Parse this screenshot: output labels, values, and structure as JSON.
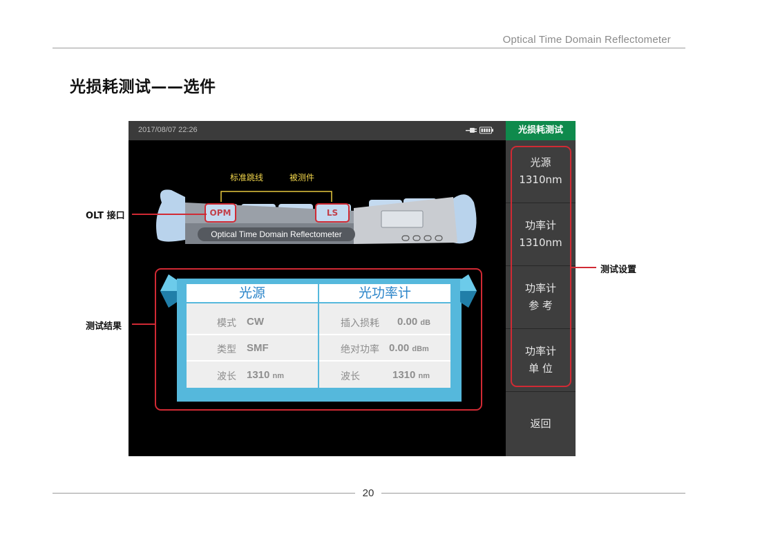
{
  "header": {
    "text": "Optical Time Domain Reflectometer"
  },
  "page_title": "光损耗测试——选件",
  "screen": {
    "datetime": "2017/08/07  22:26",
    "icons": [
      "plug-icon",
      "battery-icon"
    ],
    "side_header": "光损耗测试",
    "side_buttons": [
      {
        "line1": "光源",
        "line2": "1310nm"
      },
      {
        "line1": "功率计",
        "line2": "1310nm"
      },
      {
        "line1": "功率计",
        "line2": "参 考"
      },
      {
        "line1": "功率计",
        "line2": "单 位"
      },
      {
        "line1": "返回",
        "line2": ""
      }
    ],
    "illustration": {
      "label_jumper": "标准跳线",
      "label_dut": "被测件",
      "port_opm": "OPM",
      "port_ls": "LS",
      "device_name": "Optical Time Domain Reflectometer"
    },
    "results": {
      "left_title": "光源",
      "right_title": "光功率计",
      "left_rows": [
        {
          "label": "模式",
          "value": "CW"
        },
        {
          "label": "类型",
          "value": "SMF"
        },
        {
          "label": "波长",
          "value": "1310",
          "unit": "nm"
        }
      ],
      "right_rows": [
        {
          "label": "插入损耗",
          "value": "0.00",
          "unit": "dB"
        },
        {
          "label": "绝对功率",
          "value": "0.00",
          "unit": "dBm"
        },
        {
          "label": "波长",
          "value": "1310",
          "unit": "nm"
        }
      ]
    }
  },
  "annotations": {
    "olt": "OLT 接口",
    "results": "测试结果",
    "settings": "测试设置"
  },
  "footer": {
    "page": "20"
  },
  "colors": {
    "accent_green": "#0f8a4c",
    "highlight_red": "#d12a34",
    "table_blue": "#4bb3d9",
    "heading_blue": "#2a84c9"
  }
}
